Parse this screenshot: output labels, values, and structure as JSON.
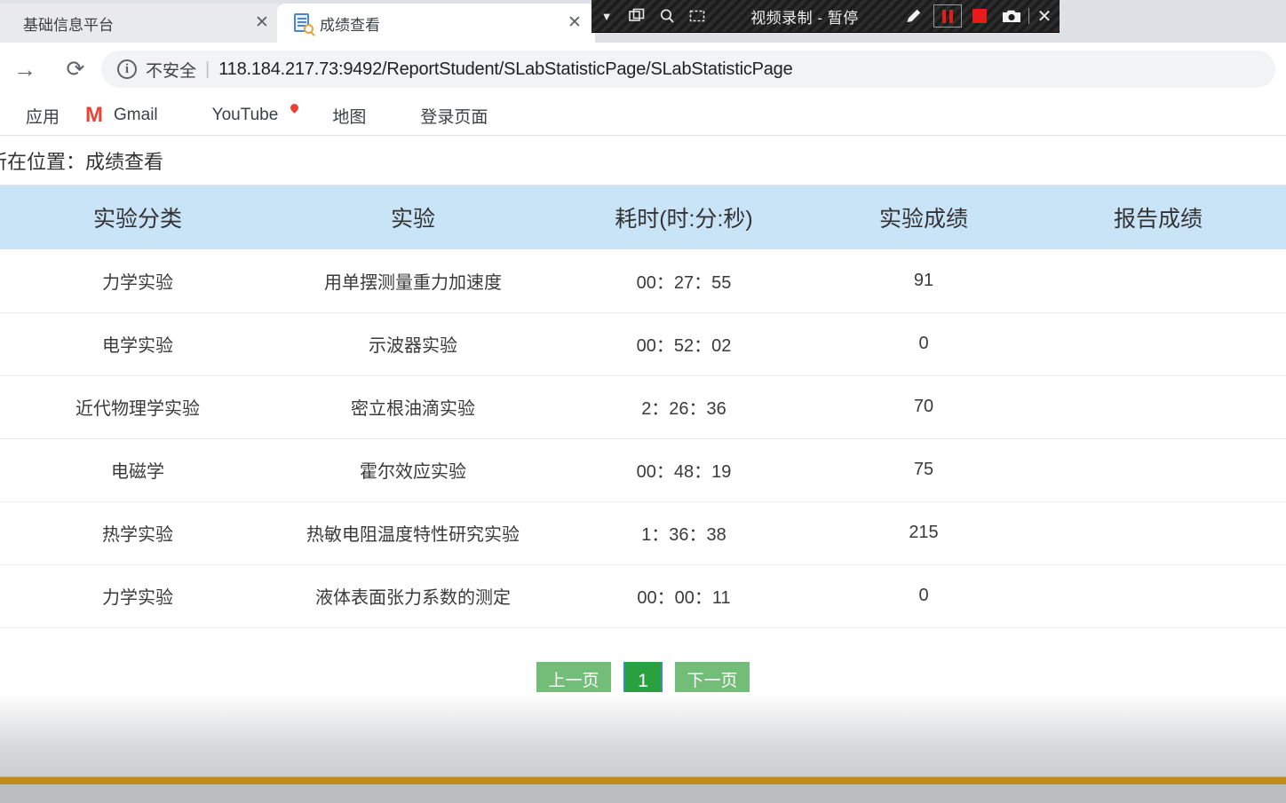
{
  "browser": {
    "tabs": [
      {
        "title": "基础信息平台",
        "active": false,
        "close_label": "✕",
        "favicon": "none"
      },
      {
        "title": "成绩查看",
        "active": true,
        "close_label": "✕",
        "favicon": "document-search-icon"
      }
    ],
    "nav": {
      "forward_icon": "→",
      "reload_icon": "⟳"
    },
    "omnibox": {
      "info_icon": "ⓘ",
      "security_label": "不安全",
      "separator": "|",
      "url": "118.184.217.73:9492/ReportStudent/SLabStatisticPage/SLabStatisticPage"
    },
    "bookmarks": [
      {
        "label": "应用",
        "icon": "apps-icon"
      },
      {
        "label": "Gmail",
        "icon": "gmail-icon"
      },
      {
        "label": "YouTube",
        "icon": "youtube-icon"
      },
      {
        "label": "地图",
        "icon": "maps-icon"
      },
      {
        "label": "登录页面",
        "icon": "globe-icon"
      }
    ]
  },
  "recorder": {
    "title": "视频录制 - 暂停",
    "caret_icon": "▼",
    "window_icon": "⧉",
    "zoom_icon": "🔍",
    "region_icon": "⬚",
    "pencil_icon": "✏",
    "pause_icon": "❚❚",
    "stop_icon": "■",
    "camera_icon": "📷",
    "divider": "|",
    "close_icon": "✕",
    "accent_color": "#e81b1b"
  },
  "page": {
    "breadcrumb": "所在位置：成绩查看",
    "table": {
      "headers": [
        "实验分类",
        "实验",
        "耗时(时:分:秒)",
        "实验成绩",
        "报告成绩"
      ],
      "header_bg": "#c9e3f7",
      "rows": [
        {
          "category": "力学实验",
          "experiment": "用单摆测量重力加速度",
          "duration": "00：27：55",
          "lab_score": "91",
          "report_score": ""
        },
        {
          "category": "电学实验",
          "experiment": "示波器实验",
          "duration": "00：52：02",
          "lab_score": "0",
          "report_score": ""
        },
        {
          "category": "近代物理学实验",
          "experiment": "密立根油滴实验",
          "duration": "2：26：36",
          "lab_score": "70",
          "report_score": ""
        },
        {
          "category": "电磁学",
          "experiment": "霍尔效应实验",
          "duration": "00：48：19",
          "lab_score": "75",
          "report_score": ""
        },
        {
          "category": "热学实验",
          "experiment": "热敏电阻温度特性研究实验",
          "duration": "1：36：38",
          "lab_score": "215",
          "report_score": ""
        },
        {
          "category": "力学实验",
          "experiment": "液体表面张力系数的测定",
          "duration": "00：00：11",
          "lab_score": "0",
          "report_score": ""
        }
      ]
    },
    "pagination": {
      "prev_label": "上一页",
      "current_page": "1",
      "next_label": "下一页",
      "button_color": "#72bd78",
      "active_color": "#2aa13f"
    },
    "footer_accent_color": "#bf8c1b"
  }
}
